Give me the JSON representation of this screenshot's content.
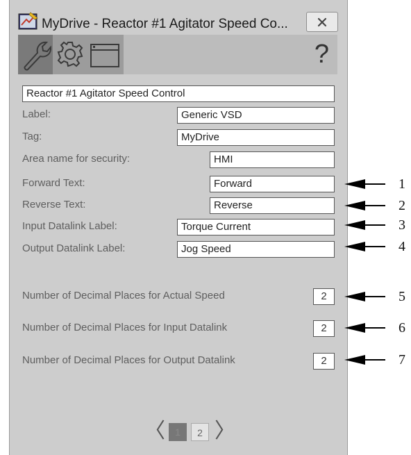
{
  "window": {
    "title": "MyDrive - Reactor #1 Agitator Speed Co...",
    "close_icon": "close-x-icon",
    "app_icon": "drive-app-icon"
  },
  "toolbar": {
    "icons": [
      "wrench-icon",
      "gear-icon",
      "window-icon"
    ],
    "help_label": "?"
  },
  "form": {
    "description": "Reactor #1 Agitator Speed Control",
    "label": {
      "label": "Label:",
      "value": "Generic VSD"
    },
    "tag": {
      "label": "Tag:",
      "value": "MyDrive"
    },
    "area": {
      "label": "Area name for security:",
      "value": "HMI"
    },
    "forward": {
      "label": "Forward Text:",
      "value": "Forward"
    },
    "reverse": {
      "label": "Reverse Text:",
      "value": "Reverse"
    },
    "input_dl": {
      "label": "Input Datalink Label:",
      "value": "Torque Current"
    },
    "output_dl": {
      "label": "Output Datalink Label:",
      "value": "Jog Speed"
    },
    "dec_actual": {
      "label": "Number of Decimal Places for Actual Speed",
      "value": "2"
    },
    "dec_input": {
      "label": "Number of Decimal Places for Input Datalink",
      "value": "2"
    },
    "dec_output": {
      "label": "Number of Decimal Places for Output Datalink",
      "value": "2"
    }
  },
  "pager": {
    "prev": "〈",
    "next": "〉",
    "pages": [
      "1",
      "2"
    ],
    "current": "1"
  },
  "callouts": [
    "1",
    "2",
    "3",
    "4",
    "5",
    "6",
    "7"
  ]
}
